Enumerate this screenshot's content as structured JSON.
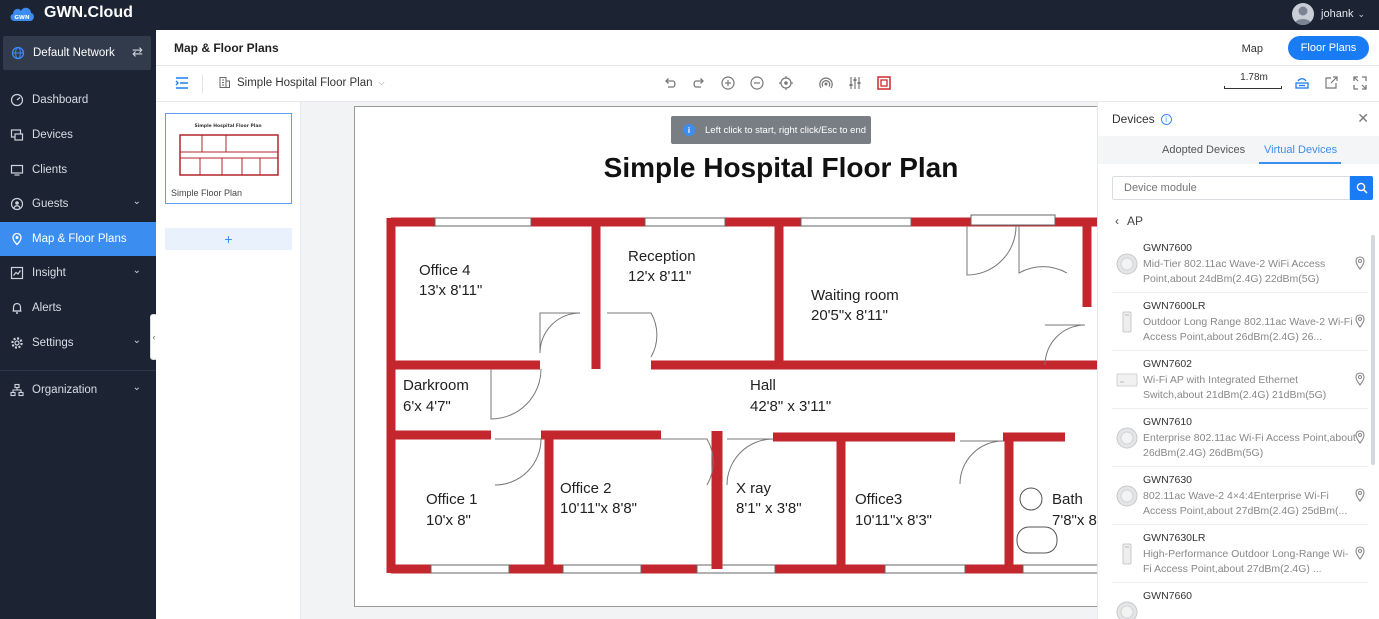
{
  "brand": {
    "name": "GWN.Cloud",
    "logo_text": "GWN"
  },
  "user": {
    "name": "johank"
  },
  "sidebar": {
    "network": "Default Network",
    "items": [
      {
        "label": "Dashboard"
      },
      {
        "label": "Devices"
      },
      {
        "label": "Clients"
      },
      {
        "label": "Guests"
      },
      {
        "label": "Map & Floor Plans"
      },
      {
        "label": "Insight"
      },
      {
        "label": "Alerts"
      },
      {
        "label": "Settings"
      },
      {
        "label": "Organization"
      }
    ]
  },
  "header": {
    "title": "Map & Floor Plans",
    "map_label": "Map",
    "floor_plans_label": "Floor Plans"
  },
  "toolbar": {
    "floor_plan": "Simple Hospital Floor Plan",
    "scale": "1.78m"
  },
  "thumbs": {
    "items": [
      {
        "label": "Simple Floor Plan",
        "mini_title": "Simple Hospital Floor Plan"
      }
    ],
    "add_label": "+"
  },
  "canvas": {
    "toast": "Left click to start, right click/Esc to end",
    "plan_title": "Simple Hospital Floor Plan",
    "rooms": [
      {
        "name": "Office 4",
        "size": "13'x 8'11\""
      },
      {
        "name": "Reception",
        "size": "12'x 8'11\""
      },
      {
        "name": "Waiting room",
        "size": "20'5\"x 8'11\""
      },
      {
        "name": "Darkroom",
        "size": "6'x 4'7\""
      },
      {
        "name": "Hall",
        "size": "42'8\" x 3'11\""
      },
      {
        "name": "Office 1",
        "size": "10'x 8\""
      },
      {
        "name": "Office 2",
        "size": "10'11\"x 8'8\""
      },
      {
        "name": "X ray",
        "size": "8'1\" x 3'8\""
      },
      {
        "name": "Office3",
        "size": "10'11\"x 8'3\""
      },
      {
        "name": "Bath",
        "size": "7'8\"x 8"
      }
    ]
  },
  "devices_panel": {
    "title": "Devices",
    "tabs": [
      "Adopted Devices",
      "Virtual Devices"
    ],
    "search_placeholder": "Device module",
    "category": "AP",
    "devices": [
      {
        "model": "GWN7600",
        "description": "Mid-Tier 802.11ac Wave-2 WiFi Access Point,about 24dBm(2.4G) 22dBm(5G)",
        "icon": "round-ap"
      },
      {
        "model": "GWN7600LR",
        "description": "Outdoor Long Range 802.11ac Wave-2 Wi-Fi Access Point,about 26dBm(2.4G) 26...",
        "icon": "outdoor-ap"
      },
      {
        "model": "GWN7602",
        "description": "Wi-Fi AP with Integrated Ethernet Switch,about 21dBm(2.4G) 21dBm(5G)",
        "icon": "wall-ap"
      },
      {
        "model": "GWN7610",
        "description": "Enterprise 802.11ac Wi-Fi Access Point,about 26dBm(2.4G) 26dBm(5G)",
        "icon": "round-ap"
      },
      {
        "model": "GWN7630",
        "description": "802.11ac Wave-2 4×4:4Enterprise Wi-Fi Access Point,about 27dBm(2.4G) 25dBm(...",
        "icon": "round-ap"
      },
      {
        "model": "GWN7630LR",
        "description": "High-Performance Outdoor Long-Range Wi-Fi Access Point,about 27dBm(2.4G) ...",
        "icon": "outdoor-ap"
      },
      {
        "model": "GWN7660",
        "description": "",
        "icon": "round-ap"
      }
    ]
  },
  "colors": {
    "accent": "#1a7cf5",
    "sidebar_bg": "#1c2433",
    "wall_red": "#c4262e"
  }
}
